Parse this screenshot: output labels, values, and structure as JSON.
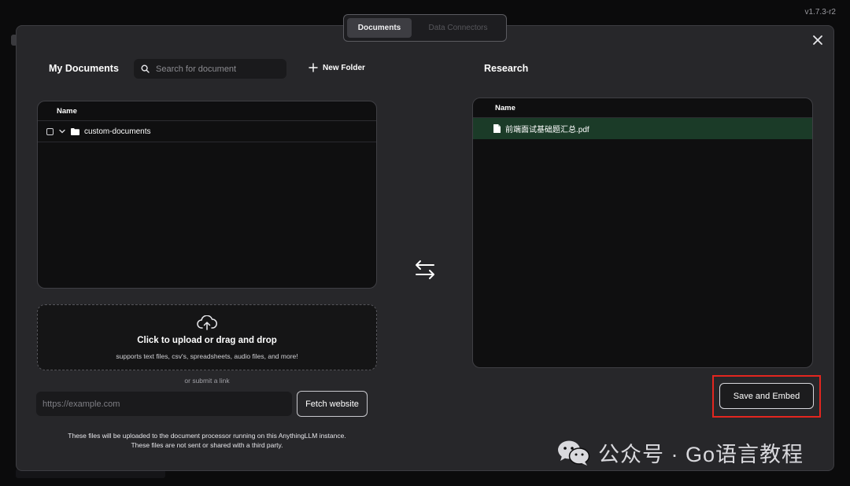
{
  "app": {
    "version": "v1.7.3-r2"
  },
  "tabs": [
    {
      "label": "Documents",
      "active": true
    },
    {
      "label": "Data Connectors",
      "active": false
    }
  ],
  "my_documents": {
    "title": "My Documents",
    "search_placeholder": "Search for document",
    "new_folder_label": "New Folder",
    "table_header": "Name",
    "items": [
      {
        "name": "custom-documents",
        "type": "folder"
      }
    ]
  },
  "upload": {
    "title": "Click to upload or drag and drop",
    "subtitle": "supports text files, csv's, spreadsheets, audio files, and more!",
    "or_link": "or submit a link",
    "url_placeholder": "https://example.com",
    "fetch_label": "Fetch website",
    "footnote_line1": "These files will be uploaded to the document processor running on this AnythingLLM instance.",
    "footnote_line2": "These files are not sent or shared with a third party."
  },
  "workspace": {
    "title": "Research",
    "table_header": "Name",
    "items": [
      {
        "name": "前端面试基础题汇总.pdf",
        "type": "file",
        "selected": true
      }
    ],
    "save_label": "Save and Embed"
  },
  "watermark": {
    "text": "公众号 · Go语言教程"
  },
  "colors": {
    "highlight": "#e3261f",
    "selected_row": "#1b3b28"
  }
}
